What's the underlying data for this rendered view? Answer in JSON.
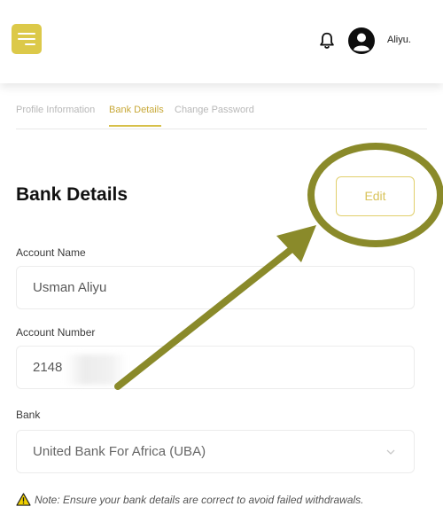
{
  "header": {
    "menu_icon": "hamburger-menu-icon",
    "notification_icon": "bell-icon",
    "avatar_icon": "user-avatar-icon",
    "username": "Aliyu."
  },
  "tabs": [
    {
      "label": "Profile Information",
      "active": false
    },
    {
      "label": "Bank Details",
      "active": true
    },
    {
      "label": "Change Password",
      "active": false
    }
  ],
  "section": {
    "title": "Bank Details",
    "edit_label": "Edit"
  },
  "fields": {
    "account_name": {
      "label": "Account Name",
      "value": "Usman Aliyu"
    },
    "account_number": {
      "label": "Account Number",
      "value": "2148"
    },
    "bank": {
      "label": "Bank",
      "value": "United Bank For Africa (UBA)"
    }
  },
  "note": {
    "icon": "warning-icon",
    "text": "Note: Ensure your bank details are correct to avoid failed withdrawals."
  },
  "colors": {
    "accent": "#dcc949",
    "annotation": "#8a8a2a"
  }
}
